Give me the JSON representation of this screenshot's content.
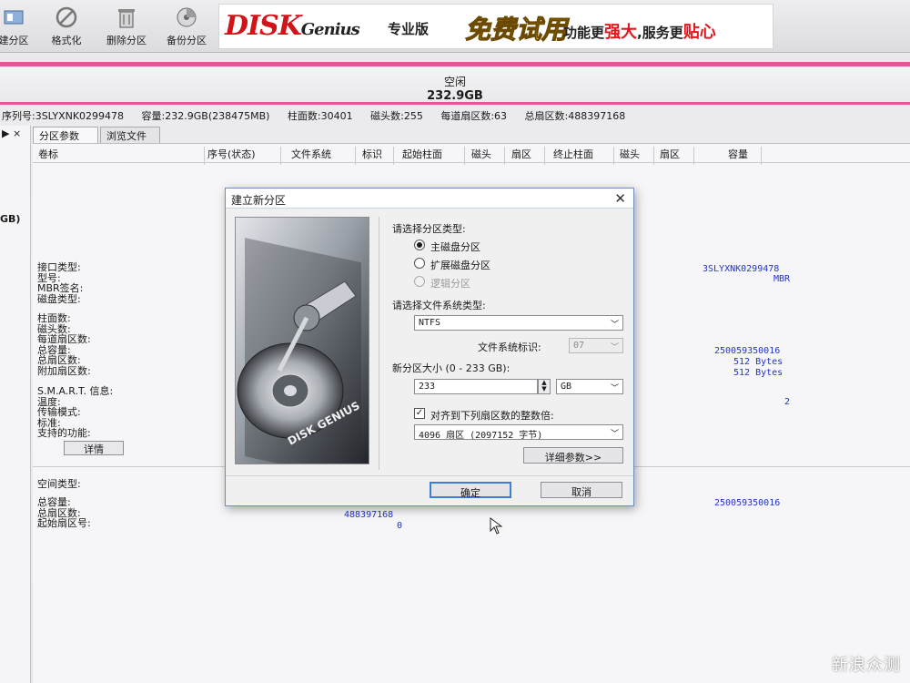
{
  "toolbar": {
    "items": [
      {
        "label": "建分区",
        "icon": "new-partition-icon"
      },
      {
        "label": "格式化",
        "icon": "format-icon"
      },
      {
        "label": "删除分区",
        "icon": "delete-icon"
      },
      {
        "label": "备份分区",
        "icon": "backup-icon"
      }
    ]
  },
  "brand": {
    "logo_main": "DISK",
    "logo_sub": "Genius",
    "edition": "专业版",
    "promo": "免费试用",
    "slogan_prefix": "功能更",
    "slogan_strong": "强大",
    "slogan_mid": ",服务更",
    "slogan_end": "贴心"
  },
  "disk": {
    "state": "空闲",
    "size": "232.9GB"
  },
  "disk_info": {
    "serial": "序列号:3SLYXNK0299478",
    "capacity": "容量:232.9GB(238475MB)",
    "cylinders": "柱面数:30401",
    "heads": "磁头数:255",
    "sectors_per_track": "每道扇区数:63",
    "total_sectors": "总扇区数:488397168"
  },
  "left_tree": {
    "close_label": "▶ ×",
    "item_label": "GB)"
  },
  "tabs": [
    {
      "label": "分区参数"
    },
    {
      "label": "浏览文件"
    }
  ],
  "columns": [
    "卷标",
    "序号(状态)",
    "文件系统",
    "标识",
    "起始柱面",
    "磁头",
    "扇区",
    "终止柱面",
    "磁头",
    "扇区",
    "容量"
  ],
  "params": {
    "group1": [
      "接口类型:",
      "型号:",
      "MBR签名:",
      "磁盘类型:"
    ],
    "group2": [
      "柱面数:",
      "磁头数:",
      "每道扇区数:",
      "总容量:",
      "总扇区数:",
      "附加扇区数:"
    ],
    "group3": [
      "S.M.A.R.T. 信息:",
      "温度:",
      "传输模式:",
      "标准:",
      "支持的功能:"
    ],
    "detail_button": "详情",
    "group4": [
      "空间类型:"
    ],
    "group5": [
      "总容量:",
      "总扇区数:",
      "起始扇区号:"
    ]
  },
  "values": {
    "serial": "3SLYXNK0299478",
    "mbr": "MBR",
    "total_bytes": "250059350016",
    "sector_size": "512 Bytes",
    "extra_sector_size": "512 Bytes",
    "smart_val": "2",
    "space_total_bytes": "250059350016",
    "space_sectors": "488397168",
    "space_start": "0"
  },
  "dialog": {
    "title": "建立新分区",
    "art_label": "DISK GENIUS",
    "partition_type_label": "请选择分区类型:",
    "partition_types": [
      {
        "label": "主磁盘分区",
        "selected": true,
        "disabled": false
      },
      {
        "label": "扩展磁盘分区",
        "selected": false,
        "disabled": false
      },
      {
        "label": "逻辑分区",
        "selected": false,
        "disabled": true
      }
    ],
    "fs_type_label": "请选择文件系统类型:",
    "fs_type_value": "NTFS",
    "fs_id_label": "文件系统标识:",
    "fs_id_value": "07",
    "size_label": "新分区大小 (0 - 233 GB):",
    "size_value": "233",
    "size_unit": "GB",
    "align_label": "对齐到下列扇区数的整数倍:",
    "align_checked": true,
    "align_value": "4096 扇区 (2097152 字节)",
    "advanced_button": "详细参数>>",
    "ok_button": "确定",
    "cancel_button": "取消"
  },
  "watermark": "新浪众测"
}
